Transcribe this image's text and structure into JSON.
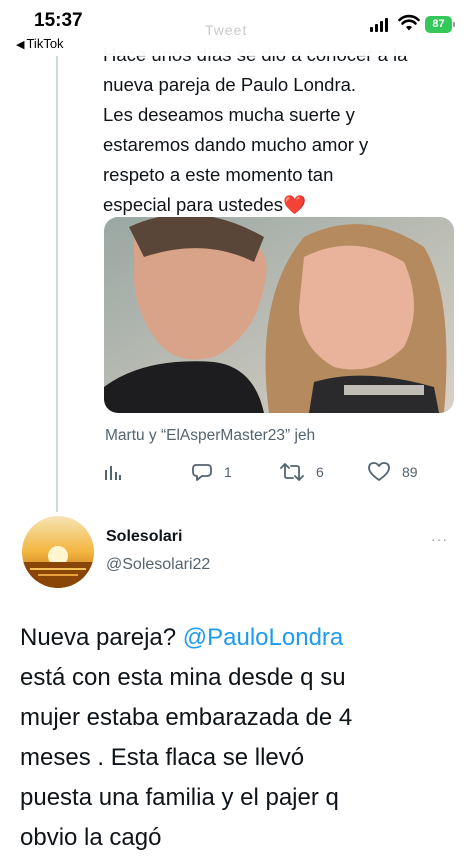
{
  "status_bar": {
    "time": "15:37",
    "back_label": "TikTok",
    "battery": "87",
    "header_ghost": "Tweet"
  },
  "quoted_tweet": {
    "text_lines": [
      "Hace unos días se dio a conocer a la",
      "nueva pareja de Paulo Londra.",
      "Les deseamos mucha suerte y",
      "estaremos dando mucho amor y",
      "respeto a este momento tan",
      "especial para ustedes"
    ],
    "emoji": "❤️",
    "reply_context": "Martu y “ElAsperMaster23” jeh",
    "stats": {
      "replies": "1",
      "retweets": "6",
      "likes": "89"
    }
  },
  "reply_tweet": {
    "author_name": "Solesolari",
    "author_handle": "@Solesolari22",
    "more_label": "···",
    "body": {
      "line1_prefix": "Nueva pareja? ",
      "mention": "@PauloLondra",
      "line2": "está con esta mina desde q su",
      "line3": "mujer estaba embarazada de 4",
      "line4": "meses . Esta flaca se llevó",
      "line5": "puesta una familia y el pajer q",
      "line6": "obvio la cagó"
    }
  },
  "colors": {
    "accent": "#1d9bf0",
    "secondary_text": "#536471",
    "heart": "#e0245e",
    "battery": "#34c759"
  },
  "icons": [
    "back-arrow-icon",
    "signal-icon",
    "wifi-icon",
    "battery-icon",
    "analytics-icon",
    "reply-icon",
    "retweet-icon",
    "like-icon",
    "more-icon"
  ]
}
